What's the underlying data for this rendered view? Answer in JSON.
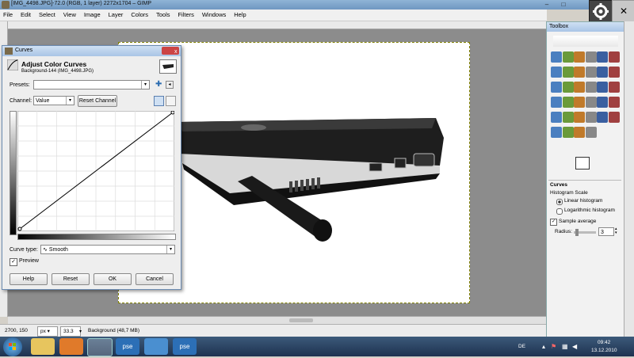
{
  "window": {
    "title": "[IMG_4498.JPG]-72.0 (RGB, 1 layer) 2272x1704 – GIMP"
  },
  "menu": [
    "File",
    "Edit",
    "Select",
    "View",
    "Image",
    "Layer",
    "Colors",
    "Tools",
    "Filters",
    "Windows",
    "Help"
  ],
  "curves": {
    "title": "Curves",
    "heading": "Adjust Color Curves",
    "subheading": "Background-144 (IMG_4498.JPG)",
    "presets_label": "Presets:",
    "presets_value": "",
    "channel_label": "Channel:",
    "channel_value": "Value",
    "reset_channel": "Reset Channel",
    "curve_type_label": "Curve type:",
    "curve_type_value": "Smooth",
    "preview_label": "Preview",
    "preview_checked": true,
    "buttons": {
      "help": "Help",
      "reset": "Reset",
      "ok": "OK",
      "cancel": "Cancel"
    },
    "close_label": "x"
  },
  "status": {
    "coords": "2700, 150",
    "unit": "px",
    "zoom": "33.3 %",
    "layer_info": "Background (48,7 MB)"
  },
  "toolbox": {
    "title": "Toolbox",
    "panel_title": "Curves",
    "histogram_scale_label": "Histogram Scale",
    "linear_label": "Linear histogram",
    "log_label": "Logarithmic histogram",
    "sample_average_label": "Sample average",
    "radius_label": "Radius:",
    "radius_value": "3",
    "radius_fraction": 0.1
  },
  "taskbar": {
    "lang": "DE",
    "time": "09:42",
    "date": "13.12.2010",
    "pse1": "pse",
    "pse2": "pse"
  },
  "colors": {
    "selection_border": "#808000",
    "title_blue": "#a9c5e6"
  }
}
